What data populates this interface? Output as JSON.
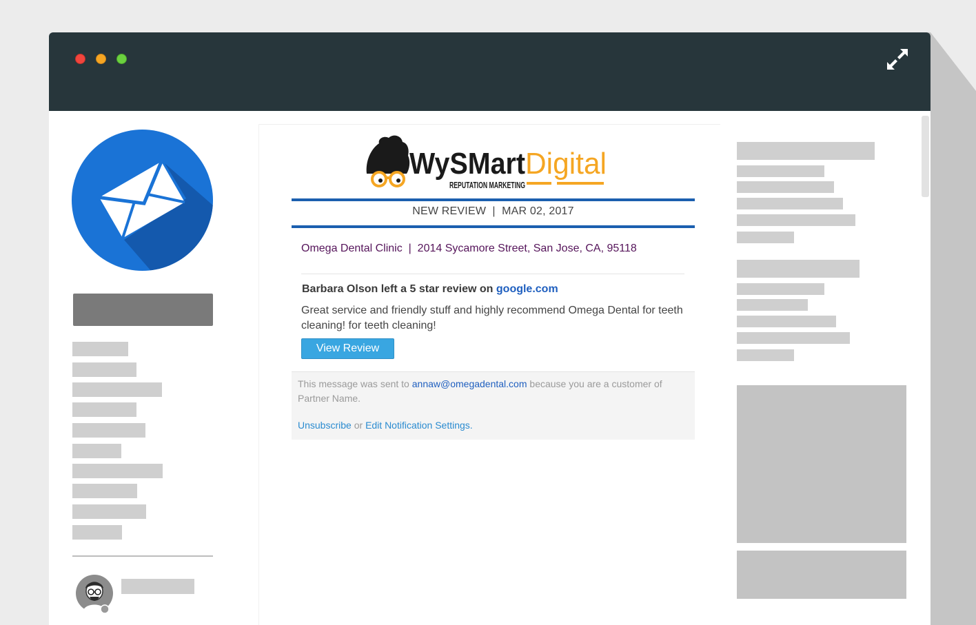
{
  "window": {
    "controls": [
      "close",
      "minimize",
      "maximize"
    ],
    "expand_icon": "expand-arrows-icon"
  },
  "sidebar": {
    "icon": "envelope-icon",
    "accent_color": "#1a73d6"
  },
  "email": {
    "logo": {
      "brand_dark": "WySMart",
      "brand_accent": "Digital",
      "tagline": "REPUTATION MARKETING"
    },
    "header": {
      "kind": "NEW REVIEW",
      "separator": "|",
      "date": "MAR 02, 2017"
    },
    "business": {
      "name": "Omega Dental Clinic",
      "separator": "|",
      "address": "2014 Sycamore Street, San Jose, CA, 95118"
    },
    "review": {
      "prefix": "Barbara Olson left a 5 star review on ",
      "site": "google.com",
      "text": "Great service and friendly stuff and highly recommend Omega Dental for teeth cleaning! for teeth cleaning!",
      "button_label": "View Review"
    },
    "footer": {
      "sent_prefix": "This message was sent to ",
      "email": "annaw@omegadental.com",
      "sent_suffix": " because you are a customer of Partner Name.",
      "unsubscribe": "Unsubscribe",
      "or": " or ",
      "settings": "Edit Notification Settings."
    }
  },
  "colors": {
    "titlebar": "#27363b",
    "rule_blue": "#1b5faf",
    "button_blue": "#39a6e1",
    "clinic_purple": "#55145a"
  }
}
